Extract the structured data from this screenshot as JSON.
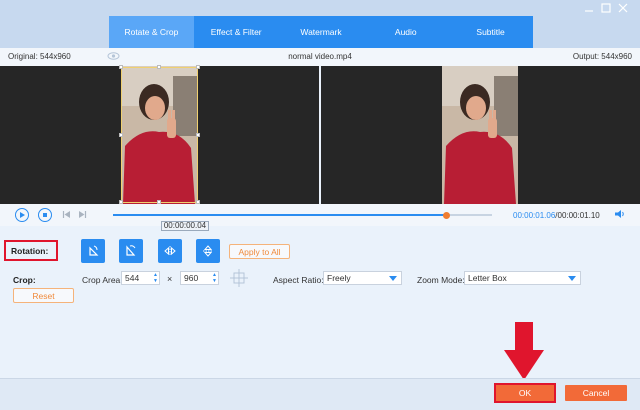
{
  "colors": {
    "accent": "#2a8cf0",
    "orange": "#f26a38",
    "highlight": "#e0152d"
  },
  "window": {
    "minimize_icon": "minimize-icon",
    "close_icon": "close-icon"
  },
  "tabs": [
    {
      "label": "Rotate & Crop",
      "active": true
    },
    {
      "label": "Effect & Filter",
      "active": false
    },
    {
      "label": "Watermark",
      "active": false
    },
    {
      "label": "Audio",
      "active": false
    },
    {
      "label": "Subtitle",
      "active": false
    }
  ],
  "info": {
    "original": "Original: 544x960",
    "filename": "normal video.mp4",
    "output": "Output: 544x960"
  },
  "playback": {
    "progress": 0.88,
    "tooltip_time": "00:00:00.04",
    "current_time": "00:00:01.06",
    "total_time": "/00:00:01.10"
  },
  "rotation": {
    "label": "Rotation:",
    "apply_all": "Apply to All"
  },
  "crop": {
    "label": "Crop:",
    "area_label": "Crop Area:",
    "width": "544",
    "times": "×",
    "height": "960",
    "reset": "Reset"
  },
  "aspect": {
    "label": "Aspect Ratio:",
    "value": "Freely"
  },
  "zoom": {
    "label": "Zoom Mode:",
    "value": "Letter Box"
  },
  "footer": {
    "ok": "OK",
    "cancel": "Cancel"
  }
}
